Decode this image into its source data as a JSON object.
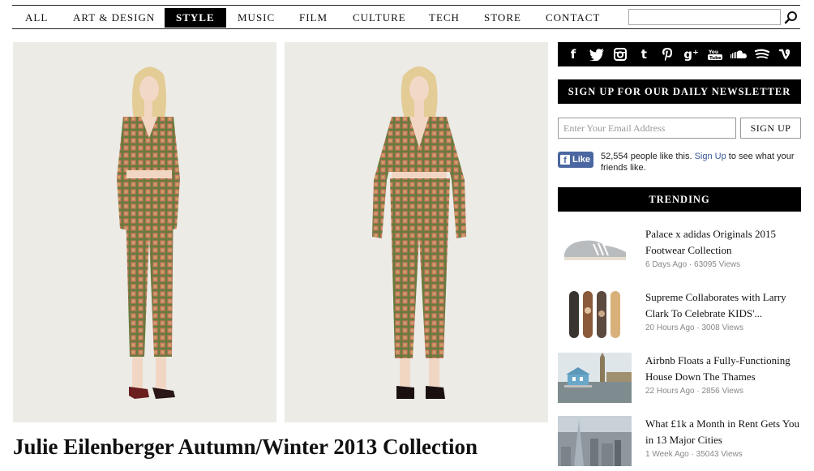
{
  "nav": {
    "items": [
      {
        "label": "ALL"
      },
      {
        "label": "ART & DESIGN"
      },
      {
        "label": "STYLE",
        "active": true
      },
      {
        "label": "MUSIC"
      },
      {
        "label": "FILM"
      },
      {
        "label": "CULTURE"
      },
      {
        "label": "TECH"
      },
      {
        "label": "STORE"
      },
      {
        "label": "CONTACT"
      }
    ],
    "search_value": ""
  },
  "article": {
    "title": "Julie Eilenberger Autumn/Winter 2013 Collection"
  },
  "social": {
    "icons": [
      {
        "name": "facebook-icon",
        "glyph": "f"
      },
      {
        "name": "twitter-icon",
        "glyph": "🐦"
      },
      {
        "name": "instagram-icon",
        "glyph": "◙"
      },
      {
        "name": "tumblr-icon",
        "glyph": "t"
      },
      {
        "name": "pinterest-icon",
        "glyph": "℘"
      },
      {
        "name": "google-plus-icon",
        "glyph": "g⁺"
      },
      {
        "name": "youtube-icon",
        "glyph": "▶"
      },
      {
        "name": "soundcloud-icon",
        "glyph": "☁"
      },
      {
        "name": "spotify-icon",
        "glyph": "≋"
      },
      {
        "name": "vine-icon",
        "glyph": "v"
      }
    ]
  },
  "newsletter": {
    "heading": "SIGN UP FOR OUR DAILY NEWSLETTER",
    "email_placeholder": "Enter Your Email Address",
    "button_label": "SIGN UP"
  },
  "facebook": {
    "button_label": "Like",
    "count_text": "52,554 people like this.",
    "signup_link": "Sign Up",
    "suffix_text": "to see what your friends like."
  },
  "trending": {
    "heading": "TRENDING",
    "items": [
      {
        "title": "Palace x adidas Originals 2015 Footwear Collection",
        "time": "6 Days Ago",
        "views": "63095 Views"
      },
      {
        "title": "Supreme Collaborates with Larry Clark To Celebrate KIDS'...",
        "time": "20 Hours Ago",
        "views": "3008 Views"
      },
      {
        "title": "Airbnb Floats a Fully-Functioning House Down The Thames",
        "time": "22 Hours Ago",
        "views": "2856 Views"
      },
      {
        "title": "What £1k a Month in Rent Gets You in 13 Major Cities",
        "time": "1 Week Ago",
        "views": "35043 Views"
      }
    ]
  },
  "colors": {
    "accent": "#000000",
    "facebook": "#4b67a1",
    "meta_gray": "#888888",
    "outfit_green": "#6a7a3c",
    "outfit_pink": "#d27a6a"
  }
}
